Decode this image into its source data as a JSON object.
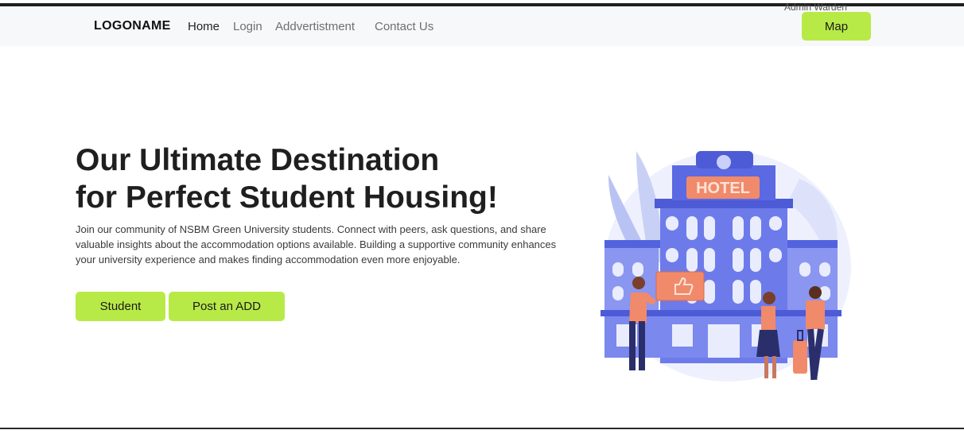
{
  "nav": {
    "logo": "LOGONAME",
    "links": [
      {
        "label": "Home"
      },
      {
        "label": "Login"
      },
      {
        "label": "Addvertistment"
      },
      {
        "label": "Contact Us"
      }
    ],
    "admin_warden": "Admin  Warden",
    "map_button": "Map"
  },
  "hero": {
    "title_line1": "Our Ultimate Destination",
    "title_line2": "for Perfect Student Housing!",
    "description": "Join our community of NSBM Green University students. Connect with peers, ask questions, and share valuable insights about the accommodation options available. Building a supportive community enhances your university experience and makes finding accommodation even more enjoyable.",
    "student_button": "Student",
    "post_button": "Post an ADD"
  },
  "illustration": {
    "sign_text": "HOTEL",
    "accent_color": "#b8ea47",
    "building_color": "#6d7bea"
  }
}
